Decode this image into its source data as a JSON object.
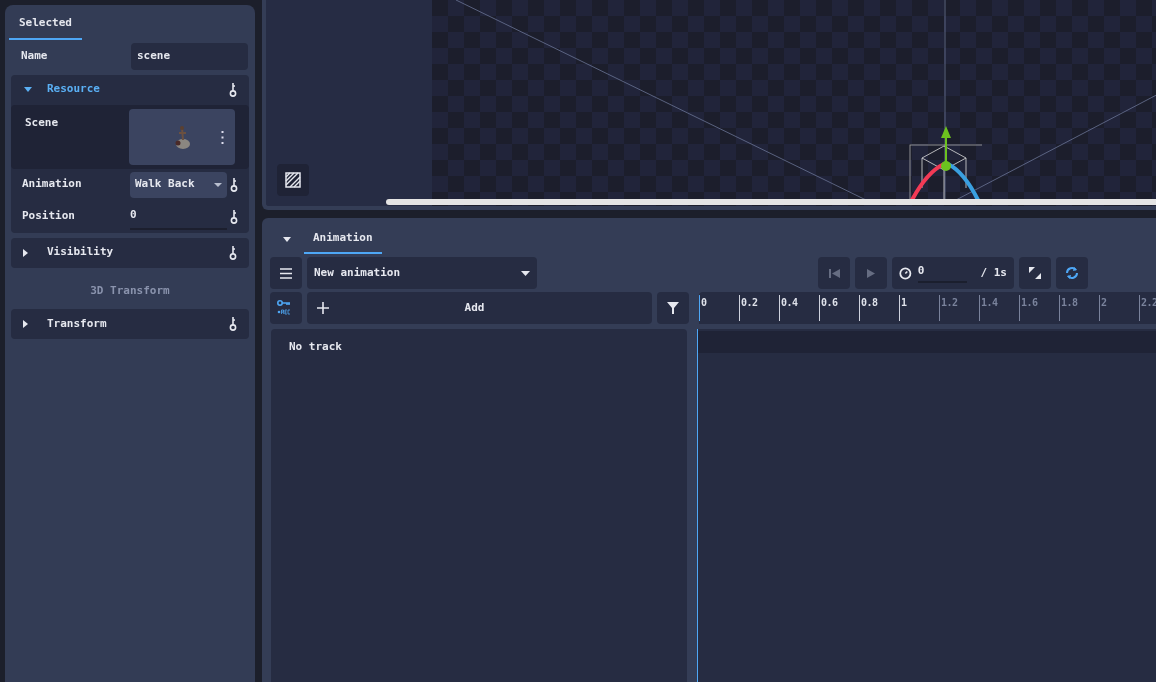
{
  "inspector": {
    "tab": {
      "label": "Selected",
      "selected": true
    },
    "name_row": {
      "label": "Name",
      "value": "scene"
    },
    "sections": [
      {
        "kind": "group",
        "title": "Resource",
        "expanded": true,
        "rows": [
          {
            "kind": "resource",
            "label": "Scene"
          },
          {
            "kind": "dropdown",
            "label": "Animation",
            "value": "Walk Back"
          },
          {
            "kind": "number",
            "label": "Position",
            "value": "0"
          }
        ]
      },
      {
        "kind": "group",
        "title": "Visibility",
        "expanded": false
      },
      {
        "kind": "category",
        "title": "3D Transform"
      },
      {
        "kind": "group",
        "title": "Transform",
        "expanded": false
      }
    ]
  },
  "animation_panel": {
    "expanded": true,
    "tabs": [
      {
        "label": "Animation",
        "selected": true
      }
    ],
    "animation_select": {
      "value": "New animation"
    },
    "playback": {
      "time": "0",
      "length": "/ 1s",
      "loop": true
    },
    "add_button": {
      "label": "Add"
    },
    "tracks_empty": "No track",
    "ruler": [
      {
        "label": "0",
        "in_range": true
      },
      {
        "label": "0.2",
        "in_range": true
      },
      {
        "label": "0.4",
        "in_range": true
      },
      {
        "label": "0.6",
        "in_range": true
      },
      {
        "label": "0.8",
        "in_range": true
      },
      {
        "label": "1",
        "in_range": true
      },
      {
        "label": "1.2",
        "in_range": false
      },
      {
        "label": "1.4",
        "in_range": false
      },
      {
        "label": "1.6",
        "in_range": false
      },
      {
        "label": "1.8",
        "in_range": false
      },
      {
        "label": "2",
        "in_range": false
      },
      {
        "label": "2.2",
        "in_range": false
      }
    ]
  }
}
